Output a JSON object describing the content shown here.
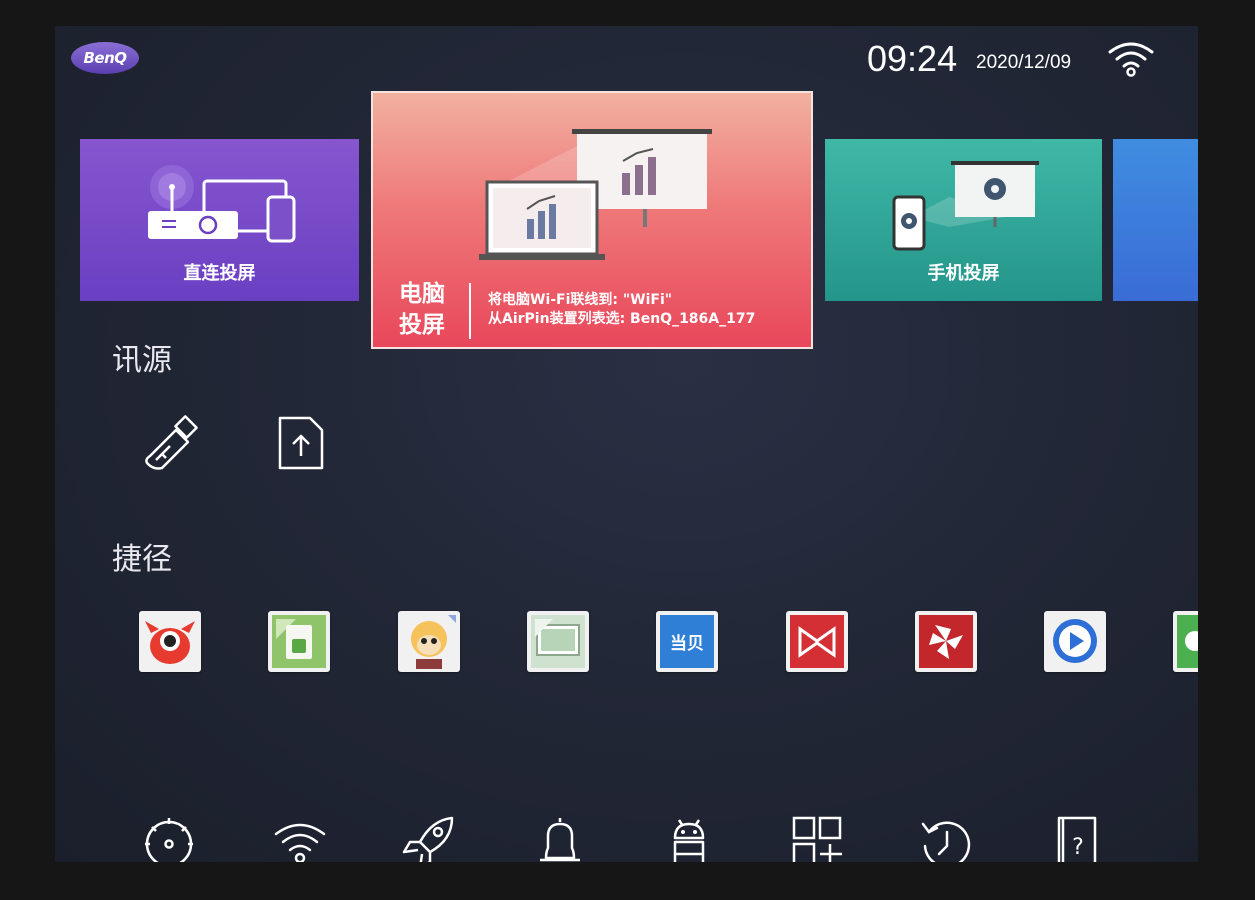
{
  "header": {
    "brand": "BenQ",
    "time": "09:24",
    "date": "2020/12/09",
    "wifi_icon": "wifi-icon"
  },
  "tiles": {
    "direct": {
      "label": "直连投屏"
    },
    "pc": {
      "title_line1": "电脑",
      "title_line2": "投屏",
      "info_line1": "将电脑Wi-Fi联线到: \"WiFi\"",
      "info_line2": "从AirPin装置列表选: BenQ_186A_177"
    },
    "phone": {
      "label": "手机投屏"
    }
  },
  "sections": {
    "source": "讯源",
    "shortcut": "捷径"
  },
  "source_icons": [
    "usb-drive-icon",
    "file-upload-icon"
  ],
  "shortcuts": [
    {
      "icon": "red-mascot-app-icon",
      "text": ""
    },
    {
      "icon": "green-file-app-icon",
      "text": ""
    },
    {
      "icon": "monkey-king-app-icon",
      "text": ""
    },
    {
      "icon": "tv-screen-app-icon",
      "text": ""
    },
    {
      "icon": "dangbei-app-icon",
      "text": "当贝"
    },
    {
      "icon": "bowtie-app-icon",
      "text": ""
    },
    {
      "icon": "red-pinwheel-app-icon",
      "text": ""
    },
    {
      "icon": "blue-play-app-icon",
      "text": ""
    },
    {
      "icon": "partial-green-app-icon",
      "text": ""
    }
  ],
  "bottom_bar": [
    "settings-icon",
    "wifi-icon",
    "rocket-icon",
    "bell-icon",
    "android-icon",
    "app-grid-icon",
    "clock-update-icon",
    "help-book-icon"
  ],
  "colors": {
    "background": "#222737",
    "direct_tile": "#7a4cc9",
    "pc_tile": "#ec5d6a",
    "phone_tile": "#2ea898",
    "more_tile": "#3d7ddc"
  }
}
